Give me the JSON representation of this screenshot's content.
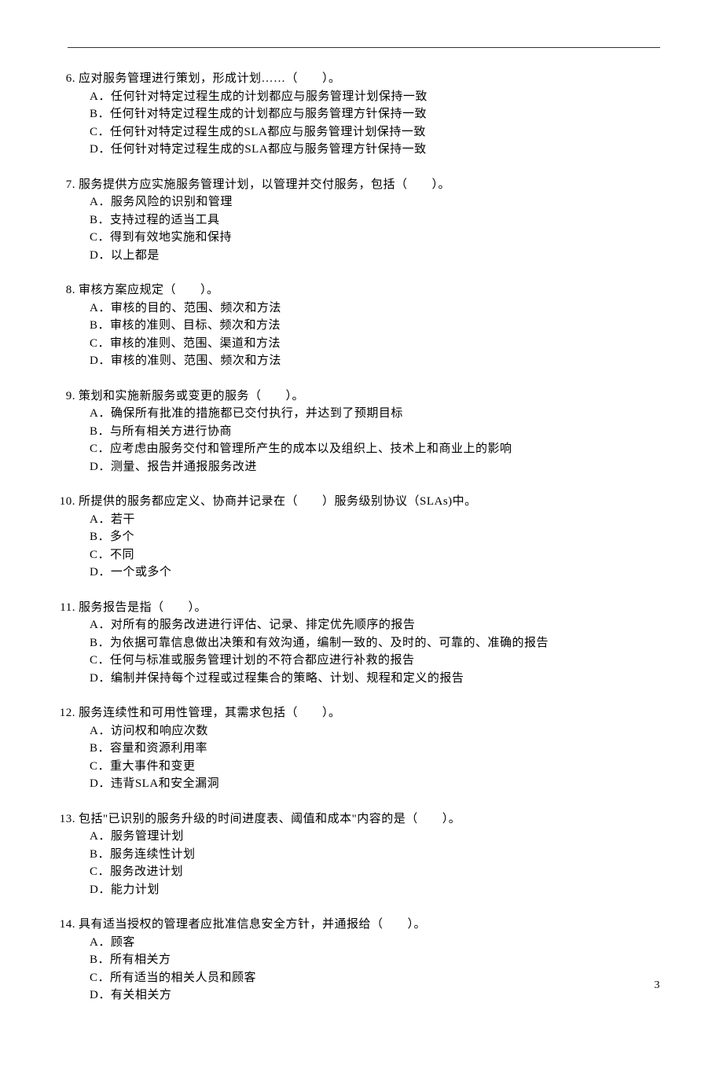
{
  "page_number": "3",
  "questions": [
    {
      "number": "6.",
      "text": "应对服务管理进行策划，形成计划……（　　）。",
      "options": [
        "A．任何针对特定过程生成的计划都应与服务管理计划保持一致",
        "B．任何针对特定过程生成的计划都应与服务管理方针保持一致",
        "C．任何针对特定过程生成的SLA都应与服务管理计划保持一致",
        "D．任何针对特定过程生成的SLA都应与服务管理方针保持一致"
      ]
    },
    {
      "number": "7.",
      "text": "服务提供方应实施服务管理计划，以管理并交付服务，包括（　　）。",
      "options": [
        "A．服务风险的识别和管理",
        "B．支持过程的适当工具",
        "C．得到有效地实施和保持",
        "D．以上都是"
      ]
    },
    {
      "number": "8.",
      "text": "审核方案应规定（　　）。",
      "options": [
        "A．审核的目的、范围、频次和方法",
        "B．审核的准则、目标、频次和方法",
        "C．审核的准则、范围、渠道和方法",
        "D．审核的准则、范围、频次和方法"
      ]
    },
    {
      "number": "9.",
      "text": "策划和实施新服务或变更的服务（　　）。",
      "options": [
        "A．确保所有批准的措施都已交付执行，并达到了预期目标",
        "B．与所有相关方进行协商",
        "C．应考虑由服务交付和管理所产生的成本以及组织上、技术上和商业上的影响",
        "D．测量、报告并通报服务改进"
      ]
    },
    {
      "number": "10.",
      "text": "所提供的服务都应定义、协商并记录在（　　）服务级别协议（SLAs)中。",
      "options": [
        "A．若干",
        "B．多个",
        "C．不同",
        "D．一个或多个"
      ]
    },
    {
      "number": "11.",
      "text": "服务报告是指（　　）。",
      "options": [
        "A．对所有的服务改进进行评估、记录、排定优先顺序的报告",
        "B．为依据可靠信息做出决策和有效沟通，编制一致的、及时的、可靠的、准确的报告",
        "C．任何与标准或服务管理计划的不符合都应进行补救的报告",
        "D．编制并保持每个过程或过程集合的策略、计划、规程和定义的报告"
      ]
    },
    {
      "number": "12.",
      "text": "服务连续性和可用性管理，其需求包括（　　）。",
      "options": [
        "A．访问权和响应次数",
        "B．容量和资源利用率",
        "C．重大事件和变更",
        "D．违背SLA和安全漏洞"
      ]
    },
    {
      "number": "13.",
      "text": "包括\"已识别的服务升级的时间进度表、阈值和成本\"内容的是（　　）。",
      "options": [
        "A．服务管理计划",
        "B．服务连续性计划",
        "C．服务改进计划",
        "D．能力计划"
      ]
    },
    {
      "number": "14.",
      "text": "具有适当授权的管理者应批准信息安全方针，并通报给（　　）。",
      "options": [
        "A．顾客",
        "B．所有相关方",
        "C．所有适当的相关人员和顾客",
        "D．有关相关方"
      ]
    }
  ]
}
